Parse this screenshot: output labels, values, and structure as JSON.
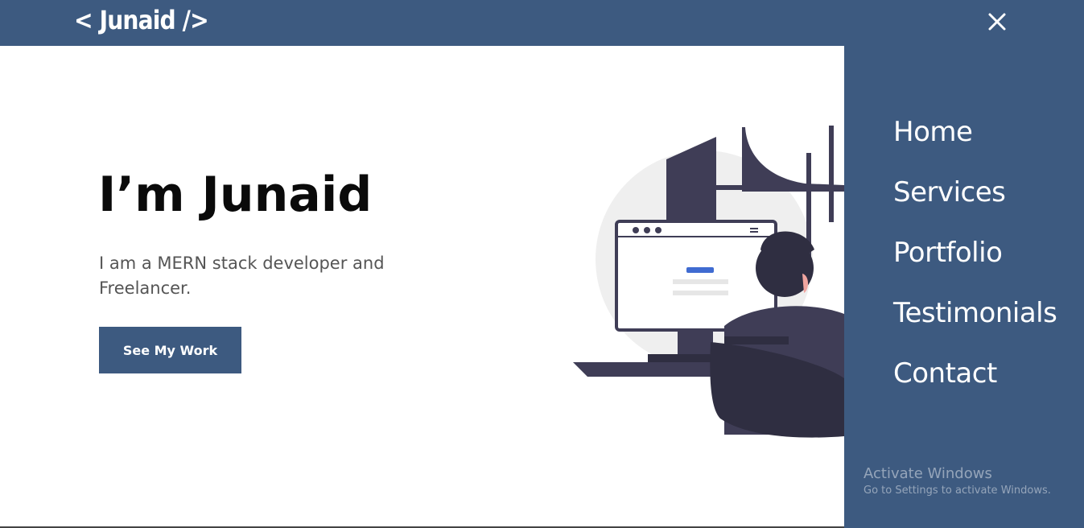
{
  "header": {
    "brand": "< Junaid />",
    "close_icon": "close-icon"
  },
  "hero": {
    "title": "I’m Junaid",
    "subtitle": "I am a MERN stack developer and Freelancer.",
    "cta_label": "See My Work"
  },
  "menu": {
    "items": [
      {
        "label": "Home"
      },
      {
        "label": "Services"
      },
      {
        "label": "Portfolio"
      },
      {
        "label": "Testimonials"
      },
      {
        "label": "Contact"
      }
    ]
  },
  "watermark": {
    "title": "Activate Windows",
    "subtitle": "Go to Settings to activate Windows."
  },
  "colors": {
    "primary": "#3d5a80",
    "dark_illustration": "#3f3d56",
    "accent_blue": "#3f6bd1"
  }
}
